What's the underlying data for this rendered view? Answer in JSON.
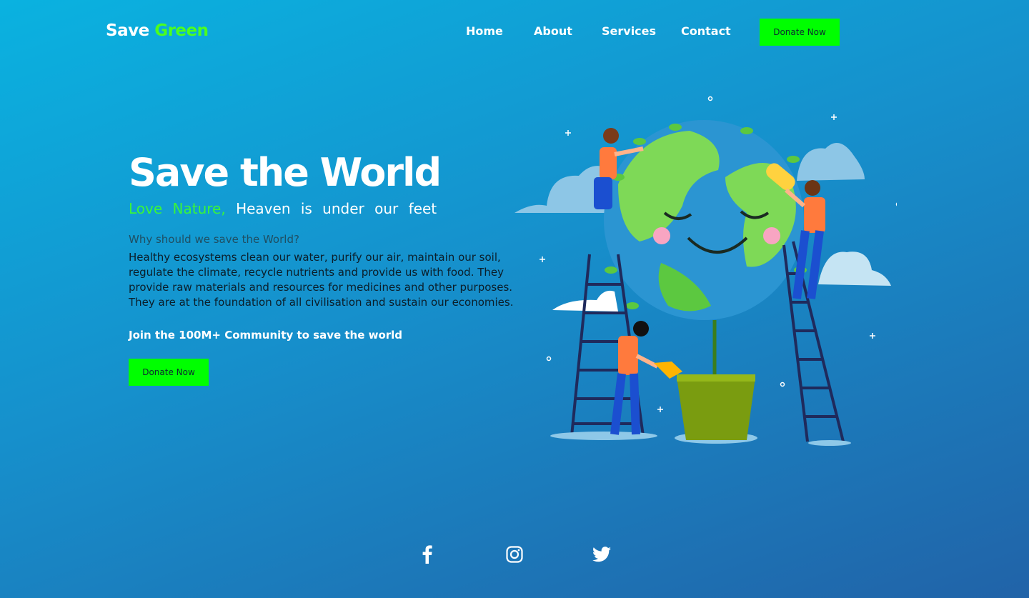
{
  "brand": {
    "word1": "Save",
    "word2": "Green"
  },
  "nav": {
    "home": "Home",
    "about": "About",
    "services": "Services",
    "contact": "Contact",
    "donate": "Donate Now"
  },
  "hero": {
    "title": "Save the World",
    "tagline_green": "Love Nature,",
    "tagline_white": "Heaven is under our feet",
    "question": "Why should we save the World?",
    "paragraph": "Healthy ecosystems clean our water, purify our air, maintain our soil, regulate the climate, recycle nutrients and provide us with food. They provide raw materials and resources for medicines and other purposes. They are at the foundation of all civilisation and sustain our economies.",
    "join": "Join the 100M+ Community to save the world",
    "donate": "Donate Now"
  },
  "socials": {
    "facebook": "facebook-icon",
    "instagram": "instagram-icon",
    "twitter": "twitter-icon"
  },
  "colors": {
    "accent": "#00ff00",
    "brand_green": "#4cff1e",
    "bg_top": "#0ab2e0",
    "bg_bottom": "#2163a8"
  }
}
